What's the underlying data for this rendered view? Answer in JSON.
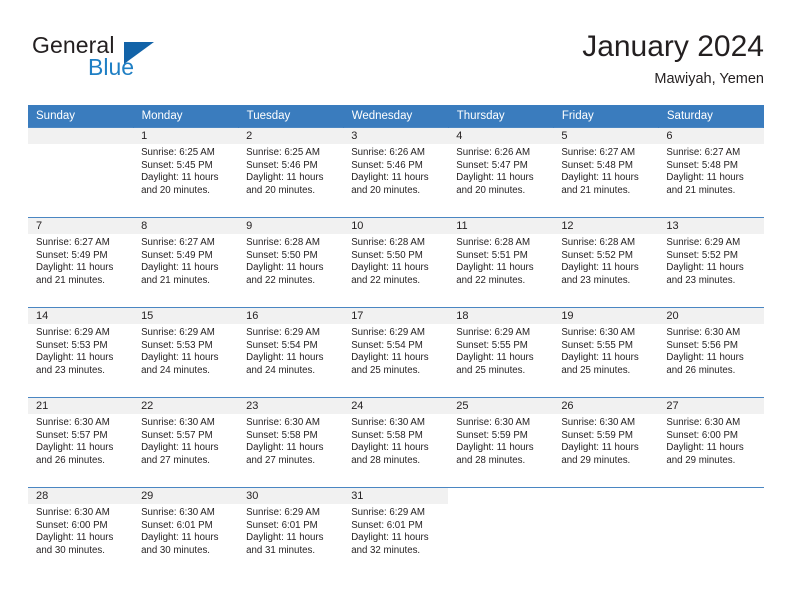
{
  "brand": {
    "name_top": "General",
    "name_bottom": "Blue",
    "accent_color": "#1263a8",
    "text_color": "#231f20",
    "triangle_icon": "triangle-icon"
  },
  "header": {
    "title": "January 2024",
    "subtitle": "Mawiyah, Yemen"
  },
  "calendar": {
    "header_bg": "#3a7cbe",
    "row_divider_color": "#4a86c2",
    "daynum_band_bg": "#f1f1f1",
    "weekdays": [
      "Sunday",
      "Monday",
      "Tuesday",
      "Wednesday",
      "Thursday",
      "Friday",
      "Saturday"
    ],
    "weeks": [
      [
        {
          "day": "",
          "sunrise": "",
          "sunset": "",
          "daylight_line1": "",
          "daylight_line2": "",
          "empty": true
        },
        {
          "day": "1",
          "sunrise": "Sunrise: 6:25 AM",
          "sunset": "Sunset: 5:45 PM",
          "daylight_line1": "Daylight: 11 hours",
          "daylight_line2": "and 20 minutes."
        },
        {
          "day": "2",
          "sunrise": "Sunrise: 6:25 AM",
          "sunset": "Sunset: 5:46 PM",
          "daylight_line1": "Daylight: 11 hours",
          "daylight_line2": "and 20 minutes."
        },
        {
          "day": "3",
          "sunrise": "Sunrise: 6:26 AM",
          "sunset": "Sunset: 5:46 PM",
          "daylight_line1": "Daylight: 11 hours",
          "daylight_line2": "and 20 minutes."
        },
        {
          "day": "4",
          "sunrise": "Sunrise: 6:26 AM",
          "sunset": "Sunset: 5:47 PM",
          "daylight_line1": "Daylight: 11 hours",
          "daylight_line2": "and 20 minutes."
        },
        {
          "day": "5",
          "sunrise": "Sunrise: 6:27 AM",
          "sunset": "Sunset: 5:48 PM",
          "daylight_line1": "Daylight: 11 hours",
          "daylight_line2": "and 21 minutes."
        },
        {
          "day": "6",
          "sunrise": "Sunrise: 6:27 AM",
          "sunset": "Sunset: 5:48 PM",
          "daylight_line1": "Daylight: 11 hours",
          "daylight_line2": "and 21 minutes."
        }
      ],
      [
        {
          "day": "7",
          "sunrise": "Sunrise: 6:27 AM",
          "sunset": "Sunset: 5:49 PM",
          "daylight_line1": "Daylight: 11 hours",
          "daylight_line2": "and 21 minutes."
        },
        {
          "day": "8",
          "sunrise": "Sunrise: 6:27 AM",
          "sunset": "Sunset: 5:49 PM",
          "daylight_line1": "Daylight: 11 hours",
          "daylight_line2": "and 21 minutes."
        },
        {
          "day": "9",
          "sunrise": "Sunrise: 6:28 AM",
          "sunset": "Sunset: 5:50 PM",
          "daylight_line1": "Daylight: 11 hours",
          "daylight_line2": "and 22 minutes."
        },
        {
          "day": "10",
          "sunrise": "Sunrise: 6:28 AM",
          "sunset": "Sunset: 5:50 PM",
          "daylight_line1": "Daylight: 11 hours",
          "daylight_line2": "and 22 minutes."
        },
        {
          "day": "11",
          "sunrise": "Sunrise: 6:28 AM",
          "sunset": "Sunset: 5:51 PM",
          "daylight_line1": "Daylight: 11 hours",
          "daylight_line2": "and 22 minutes."
        },
        {
          "day": "12",
          "sunrise": "Sunrise: 6:28 AM",
          "sunset": "Sunset: 5:52 PM",
          "daylight_line1": "Daylight: 11 hours",
          "daylight_line2": "and 23 minutes."
        },
        {
          "day": "13",
          "sunrise": "Sunrise: 6:29 AM",
          "sunset": "Sunset: 5:52 PM",
          "daylight_line1": "Daylight: 11 hours",
          "daylight_line2": "and 23 minutes."
        }
      ],
      [
        {
          "day": "14",
          "sunrise": "Sunrise: 6:29 AM",
          "sunset": "Sunset: 5:53 PM",
          "daylight_line1": "Daylight: 11 hours",
          "daylight_line2": "and 23 minutes."
        },
        {
          "day": "15",
          "sunrise": "Sunrise: 6:29 AM",
          "sunset": "Sunset: 5:53 PM",
          "daylight_line1": "Daylight: 11 hours",
          "daylight_line2": "and 24 minutes."
        },
        {
          "day": "16",
          "sunrise": "Sunrise: 6:29 AM",
          "sunset": "Sunset: 5:54 PM",
          "daylight_line1": "Daylight: 11 hours",
          "daylight_line2": "and 24 minutes."
        },
        {
          "day": "17",
          "sunrise": "Sunrise: 6:29 AM",
          "sunset": "Sunset: 5:54 PM",
          "daylight_line1": "Daylight: 11 hours",
          "daylight_line2": "and 25 minutes."
        },
        {
          "day": "18",
          "sunrise": "Sunrise: 6:29 AM",
          "sunset": "Sunset: 5:55 PM",
          "daylight_line1": "Daylight: 11 hours",
          "daylight_line2": "and 25 minutes."
        },
        {
          "day": "19",
          "sunrise": "Sunrise: 6:30 AM",
          "sunset": "Sunset: 5:55 PM",
          "daylight_line1": "Daylight: 11 hours",
          "daylight_line2": "and 25 minutes."
        },
        {
          "day": "20",
          "sunrise": "Sunrise: 6:30 AM",
          "sunset": "Sunset: 5:56 PM",
          "daylight_line1": "Daylight: 11 hours",
          "daylight_line2": "and 26 minutes."
        }
      ],
      [
        {
          "day": "21",
          "sunrise": "Sunrise: 6:30 AM",
          "sunset": "Sunset: 5:57 PM",
          "daylight_line1": "Daylight: 11 hours",
          "daylight_line2": "and 26 minutes."
        },
        {
          "day": "22",
          "sunrise": "Sunrise: 6:30 AM",
          "sunset": "Sunset: 5:57 PM",
          "daylight_line1": "Daylight: 11 hours",
          "daylight_line2": "and 27 minutes."
        },
        {
          "day": "23",
          "sunrise": "Sunrise: 6:30 AM",
          "sunset": "Sunset: 5:58 PM",
          "daylight_line1": "Daylight: 11 hours",
          "daylight_line2": "and 27 minutes."
        },
        {
          "day": "24",
          "sunrise": "Sunrise: 6:30 AM",
          "sunset": "Sunset: 5:58 PM",
          "daylight_line1": "Daylight: 11 hours",
          "daylight_line2": "and 28 minutes."
        },
        {
          "day": "25",
          "sunrise": "Sunrise: 6:30 AM",
          "sunset": "Sunset: 5:59 PM",
          "daylight_line1": "Daylight: 11 hours",
          "daylight_line2": "and 28 minutes."
        },
        {
          "day": "26",
          "sunrise": "Sunrise: 6:30 AM",
          "sunset": "Sunset: 5:59 PM",
          "daylight_line1": "Daylight: 11 hours",
          "daylight_line2": "and 29 minutes."
        },
        {
          "day": "27",
          "sunrise": "Sunrise: 6:30 AM",
          "sunset": "Sunset: 6:00 PM",
          "daylight_line1": "Daylight: 11 hours",
          "daylight_line2": "and 29 minutes."
        }
      ],
      [
        {
          "day": "28",
          "sunrise": "Sunrise: 6:30 AM",
          "sunset": "Sunset: 6:00 PM",
          "daylight_line1": "Daylight: 11 hours",
          "daylight_line2": "and 30 minutes."
        },
        {
          "day": "29",
          "sunrise": "Sunrise: 6:30 AM",
          "sunset": "Sunset: 6:01 PM",
          "daylight_line1": "Daylight: 11 hours",
          "daylight_line2": "and 30 minutes."
        },
        {
          "day": "30",
          "sunrise": "Sunrise: 6:29 AM",
          "sunset": "Sunset: 6:01 PM",
          "daylight_line1": "Daylight: 11 hours",
          "daylight_line2": "and 31 minutes."
        },
        {
          "day": "31",
          "sunrise": "Sunrise: 6:29 AM",
          "sunset": "Sunset: 6:01 PM",
          "daylight_line1": "Daylight: 11 hours",
          "daylight_line2": "and 32 minutes."
        },
        {
          "day": "",
          "sunrise": "",
          "sunset": "",
          "daylight_line1": "",
          "daylight_line2": "",
          "blank": true
        },
        {
          "day": "",
          "sunrise": "",
          "sunset": "",
          "daylight_line1": "",
          "daylight_line2": "",
          "blank": true
        },
        {
          "day": "",
          "sunrise": "",
          "sunset": "",
          "daylight_line1": "",
          "daylight_line2": "",
          "blank": true
        }
      ]
    ]
  }
}
